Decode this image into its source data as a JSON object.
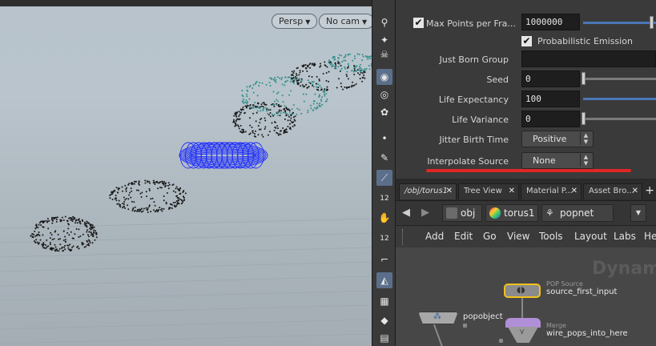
{
  "viewport": {
    "persp_label": "Persp",
    "cam_label": "No cam"
  },
  "shelf": {
    "icons": [
      "skull-icon",
      "eye-icon",
      "flower-icon",
      "hand-icon",
      "dot-icon",
      "brush-icon",
      "pin-icon",
      "number-12-icon",
      "paint-icon",
      "number-12b-icon",
      "cube-icon",
      "corner-icon",
      "shield-icon",
      "checker-icon",
      "diamond-icon",
      "stack-icon"
    ]
  },
  "params": {
    "max_points_label": "Max Points per Fra...",
    "max_points_value": "1000000",
    "prob_emission_label": "Probabilistic Emission",
    "just_born_group_label": "Just Born Group",
    "just_born_group_value": "",
    "seed_label": "Seed",
    "seed_value": "0",
    "life_expectancy_label": "Life Expectancy",
    "life_expectancy_value": "100",
    "life_variance_label": "Life Variance",
    "life_variance_value": "0",
    "jitter_label": "Jitter Birth Time",
    "jitter_value": "Positive",
    "interpolate_label": "Interpolate Source",
    "interpolate_value": "None"
  },
  "tabs": [
    {
      "label": "/obj/torus1"
    },
    {
      "label": "Tree View"
    },
    {
      "label": "Material P..."
    },
    {
      "label": "Asset Bro..."
    }
  ],
  "path": {
    "obj": "obj",
    "torus": "torus1",
    "popnet": "popnet"
  },
  "menus": [
    "Add",
    "Edit",
    "Go",
    "View",
    "Tools",
    "Layout",
    "Labs",
    "He"
  ],
  "network": {
    "watermark": "Dynam",
    "source_type": "POP Source",
    "source_name": "source_first_input",
    "popobject_name": "popobject",
    "merge_type": "Merge",
    "merge_name": "wire_pops_into_here"
  },
  "colors": {
    "torus_wire": "#1c2bff",
    "particle_dark": "#1a1a1a",
    "particle_teal": "#2f8f8a",
    "selected_node": "#f2c21b",
    "merge_node": "#b08fd8",
    "highlight": "#e02626"
  }
}
